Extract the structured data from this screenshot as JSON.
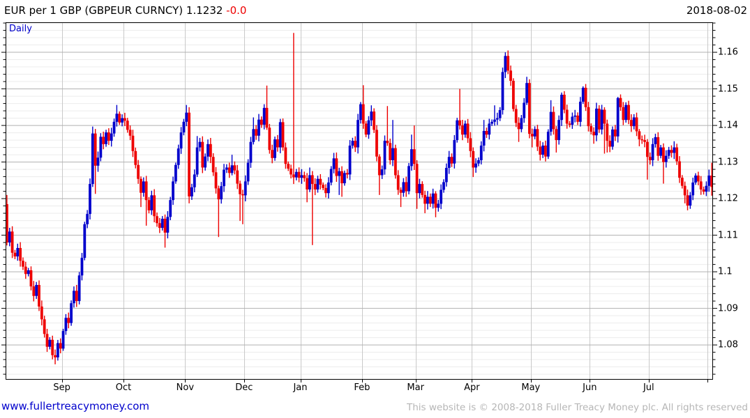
{
  "header": {
    "title_main": "EUR per 1 GBP (GBPEUR CURNCY) 1.1232 ",
    "title_change": "-0.0",
    "date": "2018-08-02"
  },
  "footer": {
    "site_link": "www.fullertreacymoney.com",
    "copyright": "This website is © 2008-2018 Fuller Treacy Money plc. All rights reserved"
  },
  "chart_data": {
    "type": "candlestick",
    "title": "EUR per 1 GBP (GBPEUR CURNCY)",
    "timeframe_label": "Daily",
    "last_price": 1.1232,
    "change_label": "-0.0",
    "date_label": "2018-08-02",
    "ylim": [
      1.0705,
      1.1682
    ],
    "y_major_step": 0.01,
    "y_minor_step": 0.002,
    "y_ticks": [
      {
        "label": "1.16",
        "value": 1.16
      },
      {
        "label": "1.15",
        "value": 1.15
      },
      {
        "label": "1.14",
        "value": 1.14
      },
      {
        "label": "1.13",
        "value": 1.13
      },
      {
        "label": "1.12",
        "value": 1.12
      },
      {
        "label": "1.11",
        "value": 1.11
      },
      {
        "label": "1.1",
        "value": 1.1
      },
      {
        "label": "1.09",
        "value": 1.09
      },
      {
        "label": "1.08",
        "value": 1.08
      }
    ],
    "months": [
      {
        "label": "Sep",
        "index": 21
      },
      {
        "label": "Oct",
        "index": 44
      },
      {
        "label": "Nov",
        "index": 67
      },
      {
        "label": "Dec",
        "index": 89
      },
      {
        "label": "Jan",
        "index": 110
      },
      {
        "label": "Feb",
        "index": 133
      },
      {
        "label": "Mar",
        "index": 153
      },
      {
        "label": "Apr",
        "index": 174
      },
      {
        "label": "May",
        "index": 196
      },
      {
        "label": "Jun",
        "index": 218
      },
      {
        "label": "Jul",
        "index": 240
      },
      {
        "label": "",
        "index": 262
      }
    ],
    "grid": true,
    "legend_position": "none",
    "first_open": 1.1185,
    "closes": [
      1.108,
      1.111,
      1.1052,
      1.1042,
      1.1065,
      1.103,
      1.1014,
      1.0994,
      1.1004,
      1.096,
      1.0934,
      1.0964,
      1.0905,
      1.087,
      1.083,
      1.0795,
      1.0814,
      1.0772,
      1.0766,
      1.0805,
      1.079,
      1.0838,
      1.0874,
      1.086,
      1.0914,
      1.0948,
      1.092,
      1.099,
      1.1038,
      1.113,
      1.1158,
      1.124,
      1.1378,
      1.129,
      1.1312,
      1.1369,
      1.1349,
      1.1381,
      1.1358,
      1.1378,
      1.141,
      1.1432,
      1.1408,
      1.142,
      1.1413,
      1.1388,
      1.1372,
      1.133,
      1.1292,
      1.1254,
      1.1216,
      1.1247,
      1.1196,
      1.1168,
      1.1209,
      1.1152,
      1.1133,
      1.112,
      1.1145,
      1.1107,
      1.115,
      1.1196,
      1.1247,
      1.1292,
      1.1337,
      1.1381,
      1.141,
      1.1435,
      1.1206,
      1.1231,
      1.1266,
      1.134,
      1.1355,
      1.1285,
      1.1315,
      1.1349,
      1.1314,
      1.1272,
      1.1228,
      1.1198,
      1.1234,
      1.1279,
      1.1285,
      1.127,
      1.1291,
      1.1277,
      1.1241,
      1.1212,
      1.1209,
      1.1247,
      1.1298,
      1.1355,
      1.139,
      1.1372,
      1.1416,
      1.1402,
      1.1448,
      1.1394,
      1.1333,
      1.1311,
      1.1362,
      1.134,
      1.1409,
      1.134,
      1.1295,
      1.1282,
      1.1266,
      1.1258,
      1.1273,
      1.1257,
      1.1264,
      1.1256,
      1.1225,
      1.1264,
      1.124,
      1.1225,
      1.1254,
      1.1238,
      1.1229,
      1.1215,
      1.1244,
      1.1281,
      1.131,
      1.1262,
      1.1275,
      1.1242,
      1.127,
      1.1266,
      1.1345,
      1.1358,
      1.134,
      1.1415,
      1.1458,
      1.1405,
      1.1375,
      1.1414,
      1.1438,
      1.1388,
      1.1315,
      1.1264,
      1.128,
      1.1358,
      1.1352,
      1.1305,
      1.1338,
      1.1264,
      1.1224,
      1.1216,
      1.1245,
      1.122,
      1.1289,
      1.1335,
      1.1295,
      1.1215,
      1.124,
      1.121,
      1.1186,
      1.1205,
      1.1186,
      1.1214,
      1.1175,
      1.1186,
      1.1224,
      1.1245,
      1.1284,
      1.1314,
      1.1296,
      1.136,
      1.1414,
      1.14,
      1.1375,
      1.1405,
      1.1365,
      1.133,
      1.1285,
      1.1296,
      1.1305,
      1.1345,
      1.1385,
      1.1375,
      1.1405,
      1.141,
      1.1416,
      1.142,
      1.1442,
      1.1546,
      1.159,
      1.155,
      1.1522,
      1.1445,
      1.1407,
      1.139,
      1.142,
      1.1462,
      1.1516,
      1.1377,
      1.137,
      1.139,
      1.1342,
      1.132,
      1.1345,
      1.1315,
      1.1383,
      1.1437,
      1.139,
      1.136,
      1.1415,
      1.1484,
      1.1443,
      1.1405,
      1.1402,
      1.1424,
      1.1427,
      1.141,
      1.1465,
      1.1503,
      1.145,
      1.1398,
      1.1383,
      1.1373,
      1.1446,
      1.1389,
      1.1443,
      1.1405,
      1.1358,
      1.1342,
      1.1389,
      1.137,
      1.1475,
      1.145,
      1.1415,
      1.1456,
      1.1415,
      1.1398,
      1.1422,
      1.1384,
      1.1362,
      1.136,
      1.1355,
      1.1314,
      1.1305,
      1.1349,
      1.1368,
      1.1317,
      1.134,
      1.13,
      1.1317,
      1.1333,
      1.1325,
      1.134,
      1.1302,
      1.1257,
      1.1235,
      1.1209,
      1.1181,
      1.1209,
      1.1244,
      1.1263,
      1.1247,
      1.1225,
      1.1219,
      1.1235,
      1.1263,
      1.1232
    ],
    "wick_overrides": {
      "0": [
        1.121,
        1.1072
      ],
      "18": [
        null,
        1.0747
      ],
      "32": [
        1.1397,
        null
      ],
      "33": [
        null,
        1.1213
      ],
      "41": [
        1.1456,
        null
      ],
      "50": [
        null,
        1.1177
      ],
      "52": [
        null,
        1.1126
      ],
      "59": [
        null,
        1.1066
      ],
      "67": [
        1.1456,
        null
      ],
      "68": [
        1.145,
        1.1187
      ],
      "71": [
        1.1371,
        null
      ],
      "79": [
        null,
        1.1095
      ],
      "84": [
        1.132,
        null
      ],
      "87": [
        null,
        1.1139
      ],
      "88": [
        null,
        1.113
      ],
      "92": [
        1.1422,
        null
      ],
      "96": [
        1.1458,
        null
      ],
      "97": [
        1.1509,
        null
      ],
      "102": [
        1.1418,
        null
      ],
      "103": [
        1.1419,
        null
      ],
      "107": [
        1.1653,
        1.124
      ],
      "112": [
        null,
        1.119
      ],
      "113": [
        1.1285,
        null
      ],
      "114": [
        null,
        1.1073
      ],
      "119": [
        null,
        1.1203
      ],
      "122": [
        1.1325,
        null
      ],
      "124": [
        null,
        1.121
      ],
      "125": [
        null,
        1.1205
      ],
      "132": [
        1.1464,
        null
      ],
      "133": [
        1.151,
        null
      ],
      "136": [
        1.1455,
        null
      ],
      "139": [
        null,
        1.121
      ],
      "142": [
        1.1453,
        null
      ],
      "144": [
        1.1415,
        null
      ],
      "147": [
        null,
        1.1177
      ],
      "151": [
        1.1375,
        null
      ],
      "152": [
        1.14,
        null
      ],
      "153": [
        null,
        1.1172
      ],
      "156": [
        null,
        1.116
      ],
      "160": [
        null,
        1.1149
      ],
      "169": [
        1.15,
        null
      ],
      "174": [
        null,
        1.1259
      ],
      "178": [
        1.1415,
        null
      ],
      "182": [
        1.1455,
        null
      ],
      "186": [
        1.16,
        null
      ],
      "187": [
        1.1605,
        null
      ],
      "191": [
        null,
        1.1355
      ],
      "194": [
        1.1533,
        null
      ],
      "195": [
        null,
        1.1365
      ],
      "196": [
        null,
        1.134
      ],
      "203": [
        1.1469,
        null
      ],
      "205": [
        null,
        1.1326
      ],
      "207": [
        1.149,
        null
      ],
      "215": [
        1.1507,
        null
      ],
      "219": [
        null,
        1.135
      ],
      "223": [
        null,
        1.1323
      ],
      "224": [
        null,
        1.1326
      ],
      "228": [
        1.1478,
        null
      ],
      "236": [
        null,
        1.1343
      ],
      "239": [
        null,
        1.1252
      ],
      "245": [
        null,
        1.1241
      ],
      "253": [
        null,
        1.1187
      ],
      "254": [
        null,
        1.1168
      ],
      "263": [
        1.1298,
        1.1208
      ]
    },
    "colors": {
      "up": "#0000cc",
      "down": "#ee0000",
      "grid_minor": "#ececec",
      "grid_major": "#b0b0b0",
      "month_line": "#c9c9c9",
      "border": "#000000",
      "accent_text": "#0000cc",
      "change_text": "#ee0000",
      "copyright_text": "#b6b6b6"
    }
  }
}
